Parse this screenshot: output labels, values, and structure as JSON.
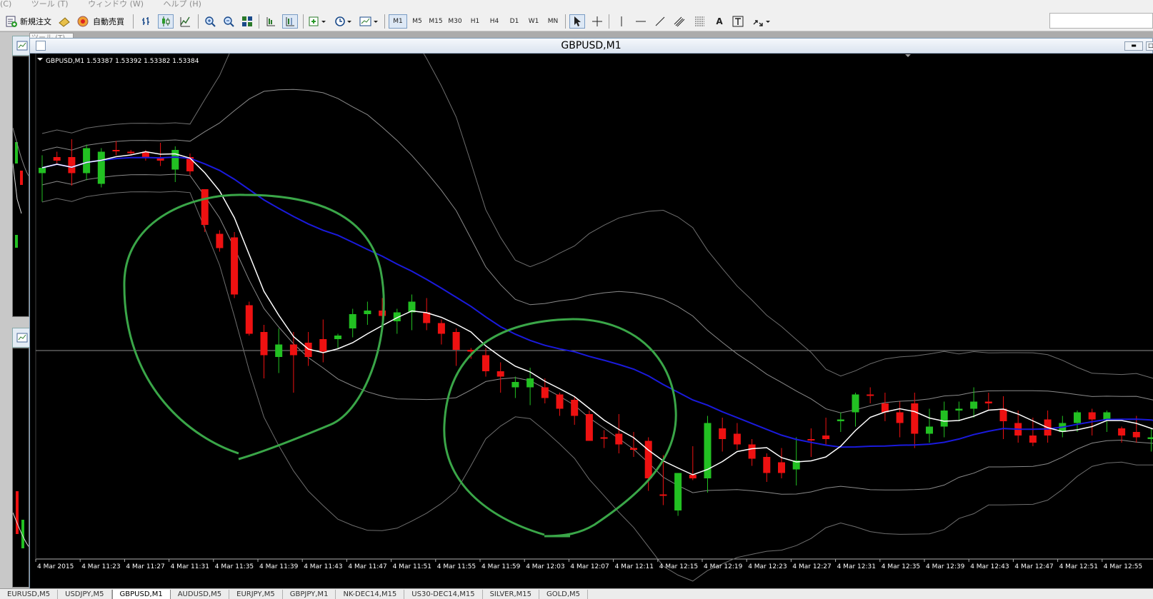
{
  "menu": {
    "items": [
      "(C)",
      "ツール (T)",
      "ウィンドウ (W)",
      "ヘルプ (H)"
    ]
  },
  "toolbar": {
    "new_order_label": "新規注文",
    "auto_trade_label": "自動売買",
    "timeframes": [
      "M1",
      "M5",
      "M15",
      "M30",
      "H1",
      "H4",
      "D1",
      "W1",
      "MN"
    ],
    "active_timeframe": "M1",
    "text_tool_label": "A"
  },
  "tooltip": {
    "text": "ツール (T)"
  },
  "chart_window": {
    "title": "GBPUSD,M1",
    "info_line": "GBPUSD,M1  1.53387 1.53392 1.53382 1.53384"
  },
  "tabs": [
    "EURUSD,M5",
    "USDJPY,M5",
    "GBPUSD,M1",
    "AUDUSD,M5",
    "EURJPY,M5",
    "GBPJPY,M1",
    "NK-DEC14,M15",
    "US30-DEC14,M15",
    "SILVER,M15",
    "GOLD,M5"
  ],
  "active_tab": "GBPUSD,M1",
  "colors": {
    "bull": "#22c022",
    "bear": "#ee1111",
    "ma_blue": "#1a1adc",
    "ma_white": "#ffffff",
    "band": "#8a8a8a",
    "circle": "#3aa648",
    "window_bg": "#000000"
  },
  "chart_data": {
    "type": "candlestick",
    "symbol": "GBPUSD",
    "timeframe": "M1",
    "x_tick_labels": [
      "4 Mar 2015",
      "4 Mar 11:23",
      "4 Mar 11:27",
      "4 Mar 11:31",
      "4 Mar 11:35",
      "4 Mar 11:39",
      "4 Mar 11:43",
      "4 Mar 11:47",
      "4 Mar 11:51",
      "4 Mar 11:55",
      "4 Mar 11:59",
      "4 Mar 12:03",
      "4 Mar 12:07",
      "4 Mar 12:11",
      "4 Mar 12:15",
      "4 Mar 12:19",
      "4 Mar 12:23",
      "4 Mar 12:27",
      "4 Mar 12:31",
      "4 Mar 12:35",
      "4 Mar 12:39",
      "4 Mar 12:43",
      "4 Mar 12:47",
      "4 Mar 12:51",
      "4 Mar 12:55"
    ],
    "y_range": [
      0,
      100
    ],
    "candles": [
      [
        27,
        24,
        43,
        17
      ],
      [
        18,
        20,
        22,
        15
      ],
      [
        18,
        27,
        34,
        8
      ],
      [
        27,
        13,
        31,
        11
      ],
      [
        33,
        15,
        35,
        13
      ],
      [
        14,
        14,
        17,
        9
      ],
      [
        15,
        15,
        17,
        14
      ],
      [
        15,
        18,
        20,
        14
      ],
      [
        18,
        20,
        23,
        10
      ],
      [
        25,
        14,
        32,
        12
      ],
      [
        18,
        26,
        28,
        16
      ],
      [
        36,
        56,
        60,
        36
      ],
      [
        61,
        69,
        71,
        59
      ],
      [
        63,
        95,
        97,
        60
      ],
      [
        101,
        117,
        118,
        99
      ],
      [
        116,
        129,
        142,
        112
      ],
      [
        130,
        123,
        139,
        114
      ],
      [
        123,
        129,
        150,
        116
      ],
      [
        122,
        130,
        135,
        116
      ],
      [
        120,
        127,
        133,
        109
      ],
      [
        120,
        118,
        125,
        117
      ],
      [
        114,
        106,
        119,
        103
      ],
      [
        106,
        104,
        112,
        99
      ],
      [
        104,
        107,
        114,
        97
      ],
      [
        110,
        105,
        117,
        103
      ],
      [
        105,
        99,
        115,
        95
      ],
      [
        105,
        111,
        115,
        97
      ],
      [
        111,
        117,
        123,
        109
      ],
      [
        116,
        126,
        135,
        114
      ],
      [
        126,
        127,
        131,
        125
      ],
      [
        129,
        138,
        141,
        125
      ],
      [
        138,
        141,
        150,
        133
      ],
      [
        147,
        144,
        153,
        141
      ],
      [
        147,
        142,
        157,
        136
      ],
      [
        147,
        153,
        156,
        142
      ],
      [
        151,
        159,
        163,
        150
      ],
      [
        154,
        163,
        168,
        152
      ],
      [
        162,
        177,
        177,
        160
      ],
      [
        175,
        175,
        181,
        171
      ],
      [
        173,
        179,
        184,
        162
      ],
      [
        181,
        182,
        186,
        172
      ],
      [
        177,
        198,
        205,
        175
      ],
      [
        207,
        207,
        213,
        185
      ],
      [
        216,
        195,
        219,
        195
      ],
      [
        196,
        198,
        199,
        180
      ],
      [
        198,
        167,
        206,
        163
      ],
      [
        170,
        176,
        183,
        164
      ],
      [
        173,
        179,
        182,
        167
      ],
      [
        179,
        187,
        191,
        176
      ],
      [
        186,
        195,
        200,
        184
      ],
      [
        189,
        195,
        198,
        181
      ],
      [
        193,
        188,
        202,
        175
      ],
      [
        176,
        176,
        186,
        170
      ],
      [
        174,
        176,
        179,
        164
      ],
      [
        166,
        165,
        172,
        161
      ],
      [
        161,
        151,
        169,
        150
      ],
      [
        151,
        151,
        156,
        147
      ],
      [
        156,
        161,
        166,
        150
      ],
      [
        161,
        167,
        175,
        155
      ],
      [
        156,
        173,
        181,
        150
      ],
      [
        173,
        169,
        178,
        159
      ],
      [
        169,
        160,
        175,
        155
      ],
      [
        160,
        159,
        166,
        155
      ],
      [
        159,
        155,
        164,
        147
      ],
      [
        155,
        156,
        160,
        150
      ],
      [
        159,
        166,
        176,
        152
      ],
      [
        167,
        174,
        178,
        160
      ],
      [
        174,
        178,
        180,
        164
      ],
      [
        165,
        174,
        178,
        160
      ],
      [
        172,
        167,
        175,
        163
      ],
      [
        167,
        161,
        172,
        160
      ],
      [
        161,
        165,
        174,
        159
      ],
      [
        165,
        161,
        172,
        160
      ],
      [
        170,
        174,
        178,
        169
      ],
      [
        172,
        175,
        178,
        163
      ],
      [
        176,
        175,
        183,
        170
      ],
      [
        175,
        178,
        185,
        169
      ]
    ],
    "ma_fast": "white",
    "ma_slow": "blue",
    "bollinger_bands": 2,
    "circles": 2
  }
}
